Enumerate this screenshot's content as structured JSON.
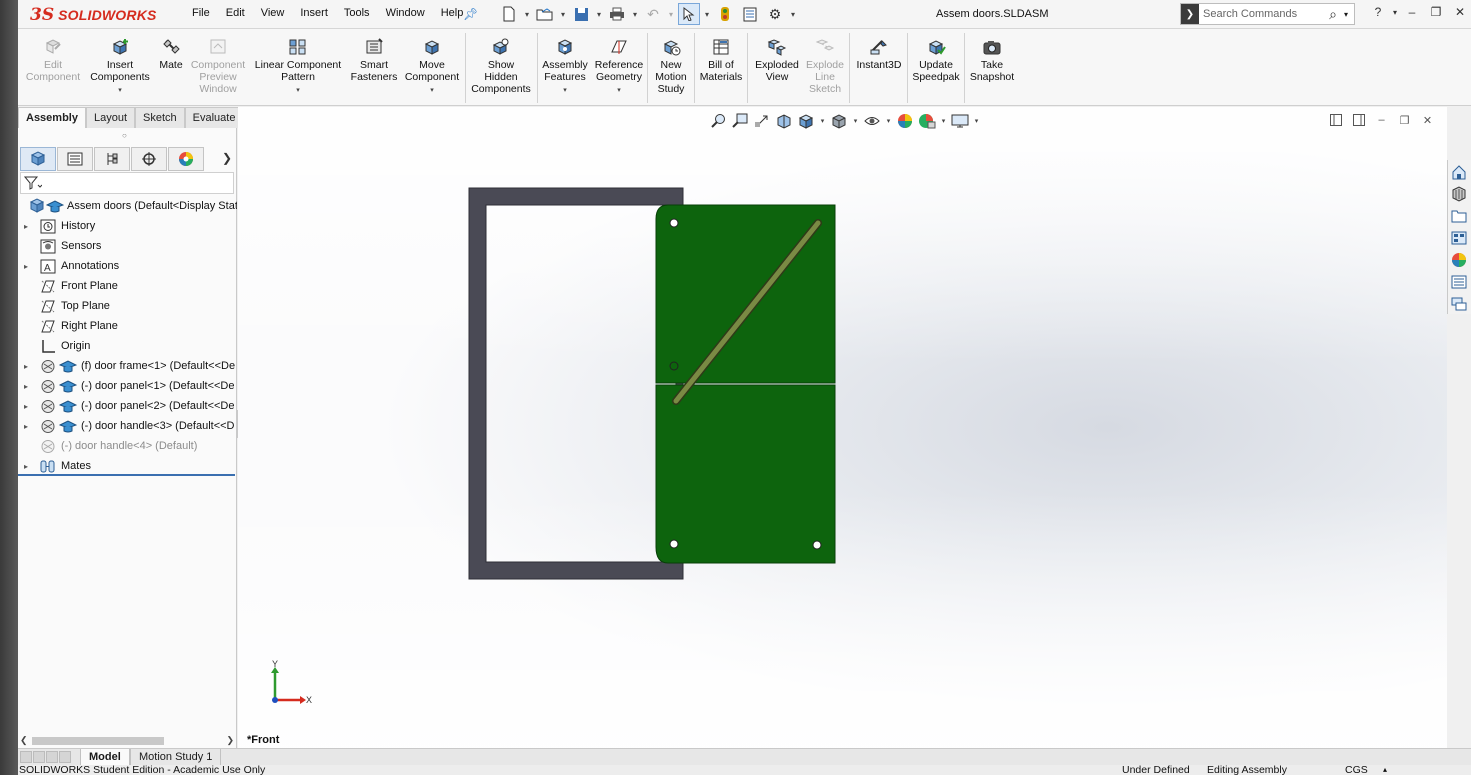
{
  "app": {
    "logo_prefix": "3S",
    "logo_text": "SOLIDWORKS",
    "doc_title": "Assem doors.SLDASM"
  },
  "menus": [
    "File",
    "Edit",
    "View",
    "Insert",
    "Tools",
    "Window",
    "Help"
  ],
  "search": {
    "placeholder": "Search Commands"
  },
  "ribbon": [
    {
      "label": "Edit\nComponent",
      "icon": "edit-component-icon",
      "enabled": false
    },
    {
      "label": "Insert\nComponents",
      "icon": "insert-components-icon",
      "enabled": true,
      "dropdown": true
    },
    {
      "label": "Mate",
      "icon": "mate-icon",
      "enabled": true
    },
    {
      "label": "Component\nPreview\nWindow",
      "icon": "component-preview-icon",
      "enabled": false
    },
    {
      "label": "Linear Component\nPattern",
      "icon": "linear-pattern-icon",
      "enabled": true,
      "dropdown": true
    },
    {
      "label": "Smart\nFasteners",
      "icon": "smart-fasteners-icon",
      "enabled": true
    },
    {
      "label": "Move\nComponent",
      "icon": "move-component-icon",
      "enabled": true,
      "dropdown": true
    },
    {
      "label": "Show\nHidden\nComponents",
      "icon": "show-hidden-icon",
      "enabled": true
    },
    {
      "label": "Assembly\nFeatures",
      "icon": "assembly-features-icon",
      "enabled": true,
      "dropdown": true
    },
    {
      "label": "Reference\nGeometry",
      "icon": "reference-geometry-icon",
      "enabled": true,
      "dropdown": true
    },
    {
      "label": "New\nMotion\nStudy",
      "icon": "motion-study-icon",
      "enabled": true
    },
    {
      "label": "Bill of\nMaterials",
      "icon": "bom-icon",
      "enabled": true
    },
    {
      "label": "Exploded\nView",
      "icon": "exploded-view-icon",
      "enabled": true
    },
    {
      "label": "Explode\nLine\nSketch",
      "icon": "explode-line-icon",
      "enabled": false
    },
    {
      "label": "Instant3D",
      "icon": "instant3d-icon",
      "enabled": true
    },
    {
      "label": "Update\nSpeedpak",
      "icon": "speedpak-icon",
      "enabled": true
    },
    {
      "label": "Take\nSnapshot",
      "icon": "snapshot-icon",
      "enabled": true
    }
  ],
  "command_tabs": [
    "Assembly",
    "Layout",
    "Sketch",
    "Evaluate"
  ],
  "tree": [
    {
      "label": "Assem doors  (Default<Display State",
      "icon": "assembly-icon",
      "expand": false,
      "dim": false
    },
    {
      "label": "History",
      "icon": "history-icon",
      "expand": true,
      "dim": false
    },
    {
      "label": "Sensors",
      "icon": "sensors-icon",
      "expand": false,
      "dim": false
    },
    {
      "label": "Annotations",
      "icon": "annotations-icon",
      "expand": true,
      "dim": false
    },
    {
      "label": "Front Plane",
      "icon": "plane-icon",
      "expand": false,
      "dim": false
    },
    {
      "label": "Top Plane",
      "icon": "plane-icon",
      "expand": false,
      "dim": false
    },
    {
      "label": "Right Plane",
      "icon": "plane-icon",
      "expand": false,
      "dim": false
    },
    {
      "label": "Origin",
      "icon": "origin-icon",
      "expand": false,
      "dim": false
    },
    {
      "label": "(f) door frame<1>  (Default<<De",
      "icon": "part-icon",
      "expand": true,
      "dim": false
    },
    {
      "label": "(-) door panel<1>  (Default<<De",
      "icon": "part-icon",
      "expand": true,
      "dim": false
    },
    {
      "label": "(-) door panel<2>  (Default<<De",
      "icon": "part-icon",
      "expand": true,
      "dim": false
    },
    {
      "label": "(-) door handle<3>  (Default<<D",
      "icon": "part-icon",
      "expand": true,
      "dim": false
    },
    {
      "label": "(-) door handle<4>  (Default)",
      "icon": "part-suppressed-icon",
      "expand": false,
      "dim": true
    },
    {
      "label": "Mates",
      "icon": "mates-icon",
      "expand": true,
      "dim": false
    }
  ],
  "view_name": "*Front",
  "triad": {
    "y": "Y",
    "x": "X"
  },
  "bottom_tabs": [
    "Model",
    "Motion Study 1"
  ],
  "status": {
    "edition": "SOLIDWORKS Student Edition - Academic Use Only",
    "defined": "Under Defined",
    "mode": "Editing Assembly",
    "units": "CGS"
  },
  "colors": {
    "accent": "#d52b1e",
    "frame": "#4a4a55",
    "panel": "#0d640d",
    "handle": "#6b7a3a"
  }
}
